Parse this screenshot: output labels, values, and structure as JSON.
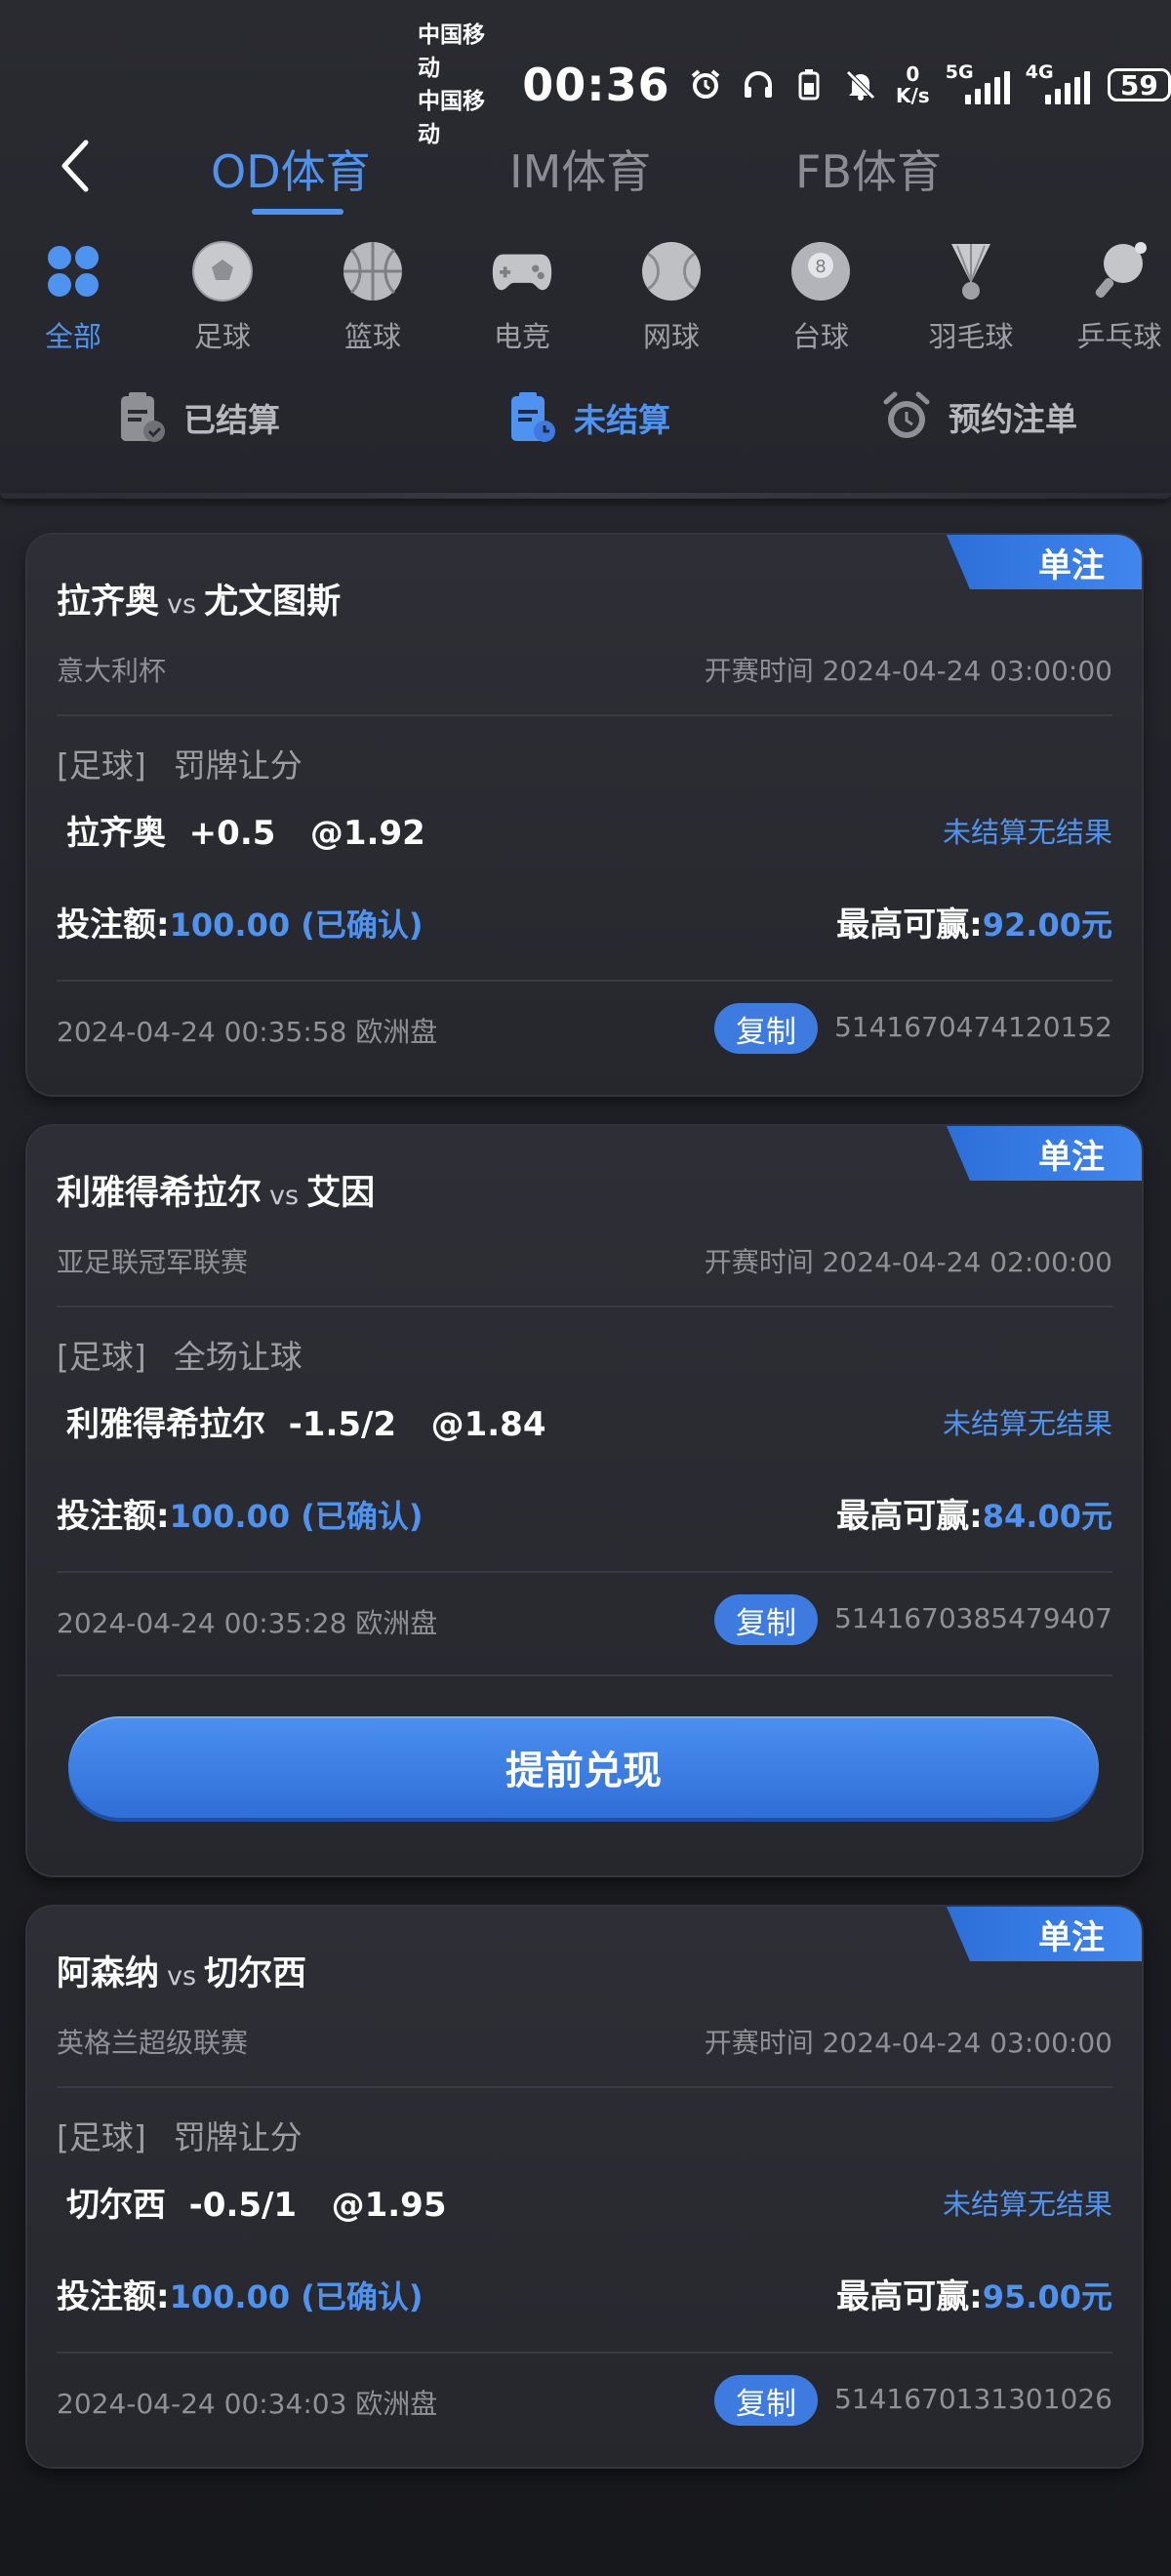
{
  "status_bar": {
    "carrier1": "中国移动",
    "carrier2": "中国移动",
    "time": "00:36",
    "speed_value": "0",
    "speed_unit": "K/s",
    "net1": "5G",
    "net2": "4G",
    "battery": "59"
  },
  "header": {
    "tabs": [
      {
        "label": "OD体育"
      },
      {
        "label": "IM体育"
      },
      {
        "label": "FB体育"
      }
    ]
  },
  "categories": [
    {
      "label": "全部",
      "icon": "grid-icon"
    },
    {
      "label": "足球",
      "icon": "soccer-icon"
    },
    {
      "label": "篮球",
      "icon": "basketball-icon"
    },
    {
      "label": "电竞",
      "icon": "gamepad-icon"
    },
    {
      "label": "网球",
      "icon": "tennis-icon"
    },
    {
      "label": "台球",
      "icon": "billiards-icon"
    },
    {
      "label": "羽毛球",
      "icon": "badminton-icon"
    },
    {
      "label": "乒乓球",
      "icon": "pingpong-icon"
    }
  ],
  "filters": [
    {
      "label": "已结算",
      "icon": "settled-icon"
    },
    {
      "label": "未结算",
      "icon": "unsettled-icon"
    },
    {
      "label": "预约注单",
      "icon": "alarm-icon"
    }
  ],
  "labels": {
    "stake": "投注额:",
    "max_win": "最高可赢:",
    "copy": "复制",
    "cashout": "提前兑现"
  },
  "bets": [
    {
      "badge": "单注",
      "home": "拉齐奥",
      "vs": "vs",
      "away": "尤文图斯",
      "league": "意大利杯",
      "start": "开赛时间 2024-04-24 03:00:00",
      "sport": "[足球]",
      "market": "罚牌让分",
      "selection": "拉齐奥  +0.5   @1.92",
      "result": "未结算无结果",
      "stake": "100.00 (已确认)",
      "max_win": "92.00元",
      "bet_time": "2024-04-24 00:35:58 欧洲盘",
      "order_no": "5141670474120152"
    },
    {
      "badge": "单注",
      "home": "利雅得希拉尔",
      "vs": "vs",
      "away": "艾因",
      "league": "亚足联冠军联赛",
      "start": "开赛时间 2024-04-24 02:00:00",
      "sport": "[足球]",
      "market": "全场让球",
      "selection": "利雅得希拉尔  -1.5/2   @1.84",
      "result": "未结算无结果",
      "stake": "100.00 (已确认)",
      "max_win": "84.00元",
      "bet_time": "2024-04-24 00:35:28 欧洲盘",
      "order_no": "5141670385479407"
    },
    {
      "badge": "单注",
      "home": "阿森纳",
      "vs": "vs",
      "away": "切尔西",
      "league": "英格兰超级联赛",
      "start": "开赛时间 2024-04-24 03:00:00",
      "sport": "[足球]",
      "market": "罚牌让分",
      "selection": "切尔西  -0.5/1   @1.95",
      "result": "未结算无结果",
      "stake": "100.00 (已确认)",
      "max_win": "95.00元",
      "bet_time": "2024-04-24 00:34:03 欧洲盘",
      "order_no": "5141670131301026"
    }
  ]
}
